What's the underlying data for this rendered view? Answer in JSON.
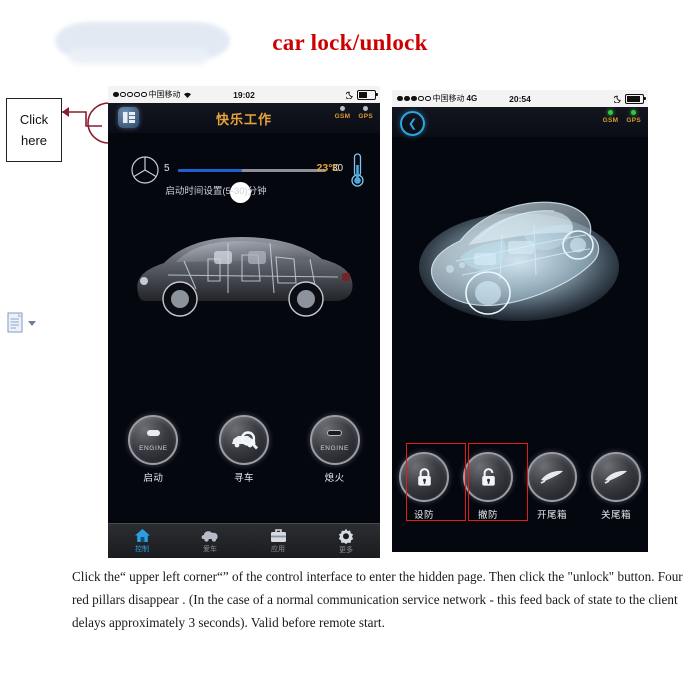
{
  "page": {
    "title": "car lock/unlock",
    "title_color": "#cc0000",
    "caption": "Click the“  upper left corner“”  of the control interface to enter the hidden page. Then click the \"unlock\" button. Four red pillars disappear . (In the case of a normal communication service network - this feed back of state to the client delays approximately 3 seconds). Valid before remote start."
  },
  "annotation": {
    "click_here_line1": "Click",
    "click_here_line2": "here",
    "arrow_color": "#8c1d2e",
    "circle_color": "#8c1d2e",
    "doc_icon": "document-icon",
    "doc_dropdown": "chevron-down-icon"
  },
  "phone_left": {
    "status": {
      "carrier": "中国移动",
      "signal_dots": 5,
      "signal_filled": 1,
      "wifi_icon": "wifi-icon",
      "time": "19:02",
      "moon_icon": "moon-icon",
      "battery_level": 55
    },
    "header": {
      "title": "快乐工作",
      "title_color": "#e8a33d",
      "menu_icon": "menu-grid-icon",
      "indicators": [
        {
          "label": "GSM",
          "color": "#b9bdc6"
        },
        {
          "label": "GPS",
          "color": "#b9bdc6"
        }
      ]
    },
    "slider": {
      "brand_icon": "mercedes-benz-logo",
      "min": "5",
      "max": "30",
      "label": "启动时间设置(5-30)分钟",
      "fill_color": "#1f5fd0",
      "value_pct": 43
    },
    "temperature": {
      "value": "23°C",
      "color": "#e0a33c",
      "icon": "thermometer-icon"
    },
    "car_image": "car-xray-side-view",
    "buttons": [
      {
        "label": "启动",
        "icon": "engine-start-icon",
        "sub": "ENGINE",
        "style": "light"
      },
      {
        "label": "寻车",
        "icon": "find-car-icon",
        "sub": "",
        "style": "car"
      },
      {
        "label": "熄火",
        "icon": "engine-stop-icon",
        "sub": "ENGINE",
        "style": "dark"
      }
    ],
    "tabs": [
      {
        "label": "控制",
        "icon": "home-icon",
        "active": true
      },
      {
        "label": "爱车",
        "icon": "cloud-car-icon",
        "active": false
      },
      {
        "label": "应用",
        "icon": "briefcase-icon",
        "active": false
      },
      {
        "label": "更多",
        "icon": "gear-icon",
        "active": false
      }
    ]
  },
  "phone_right": {
    "status": {
      "carrier": "中国移动",
      "network": "4G",
      "signal_dots": 5,
      "signal_filled": 3,
      "time": "20:54",
      "moon_icon": "moon-icon",
      "battery_level": 90
    },
    "header": {
      "back_icon": "back-chevron-icon",
      "indicators": [
        {
          "label": "GSM",
          "color": "#2ecc40"
        },
        {
          "label": "GPS",
          "color": "#2ecc40"
        }
      ]
    },
    "car_image": "car-xray-3d-view",
    "buttons": [
      {
        "label": "设防",
        "icon": "lock-closed-icon",
        "highlighted": true
      },
      {
        "label": "撤防",
        "icon": "lock-open-icon",
        "highlighted": true
      },
      {
        "label": "开尾箱",
        "icon": "trunk-open-icon",
        "highlighted": false
      },
      {
        "label": "关尾箱",
        "icon": "trunk-close-icon",
        "highlighted": false
      }
    ],
    "highlight_color": "#e01b1b"
  }
}
